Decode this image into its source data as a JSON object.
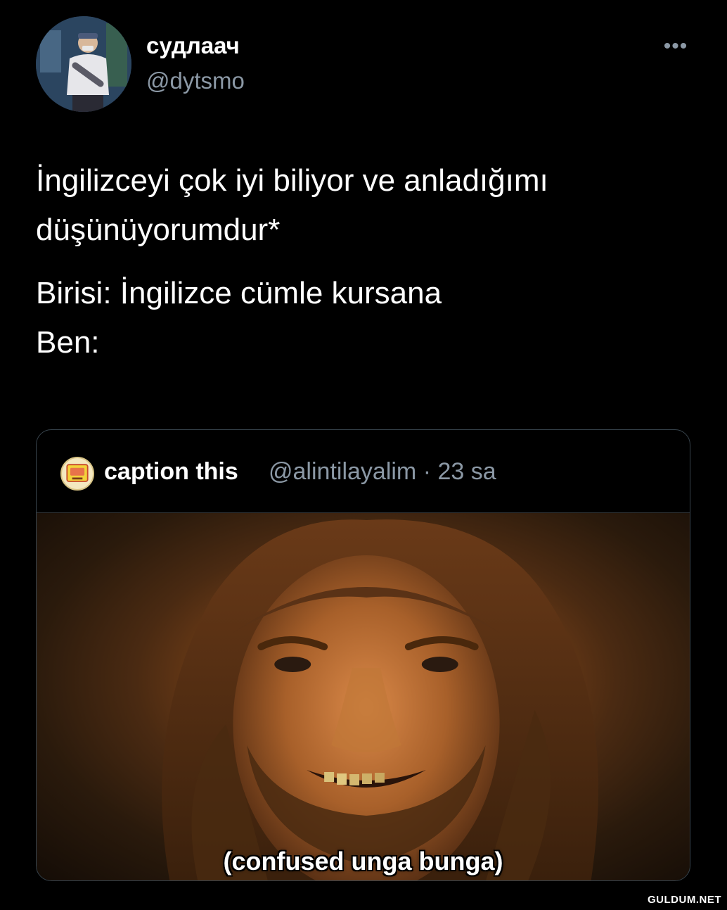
{
  "tweet": {
    "display_name": "судлаач",
    "handle": "@dytsmo",
    "more_icon": "more-horizontal-icon",
    "text_line_1": "İngilizceyi çok iyi biliyor ve anladığımı düşünüyorumdur*",
    "text_line_2": "Birisi: İngilizce cümle kursana",
    "text_line_3": "Ben:"
  },
  "quote": {
    "display_name": "caption this",
    "meta": "@alintilayalim · 23 sa",
    "media_caption": "(confused unga bunga)"
  },
  "watermark": "GULDUM.NET",
  "colors": {
    "background": "#000000",
    "primary_text": "#ffffff",
    "secondary_text": "#8b98a5",
    "border": "#38444d"
  }
}
